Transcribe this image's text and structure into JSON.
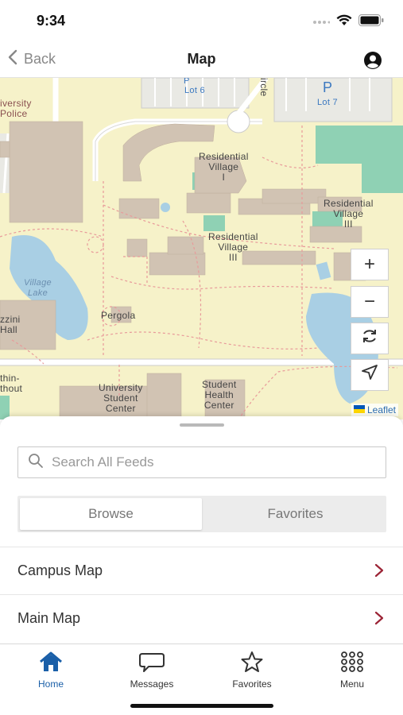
{
  "status": {
    "time": "9:34"
  },
  "nav": {
    "back_label": "Back",
    "title": "Map"
  },
  "map": {
    "labels": {
      "lot6": "Lot 6",
      "lot7": "Lot 7",
      "res_village_1": "Residential\nVillage\nI",
      "res_village_2": "Residential\nVillage\nIII",
      "res_village_3": "Residential\nVillage\nIII",
      "village_lake": "Village\nLake",
      "pergola": "Pergola",
      "student_center": "University\nStudent\nCenter",
      "health_center": "Student\nHealth\nCenter",
      "police": "iversity\nPolice",
      "hall": "zzini\nHall",
      "thin": "thin-\nthout",
      "circle": "ircle"
    },
    "controls": {
      "zoom_in": "+",
      "zoom_out": "−"
    },
    "attribution": "Leaflet"
  },
  "sheet": {
    "search_placeholder": "Search All Feeds",
    "segments": [
      "Browse",
      "Favorites"
    ],
    "active_segment": "Browse",
    "rows": [
      "Campus Map",
      "Main Map"
    ]
  },
  "tabs": [
    {
      "label": "Home",
      "icon": "home-icon",
      "active": true
    },
    {
      "label": "Messages",
      "icon": "messages-icon",
      "active": false
    },
    {
      "label": "Favorites",
      "icon": "star-icon",
      "active": false
    },
    {
      "label": "Menu",
      "icon": "grid-menu-icon",
      "active": false
    }
  ],
  "colors": {
    "accent": "#1a5fa8",
    "chevron": "#9b2335",
    "map_bg": "#f6f2c9",
    "building": "#d1c3b3",
    "water": "#a9cfe4",
    "green": "#8fd1b4"
  }
}
